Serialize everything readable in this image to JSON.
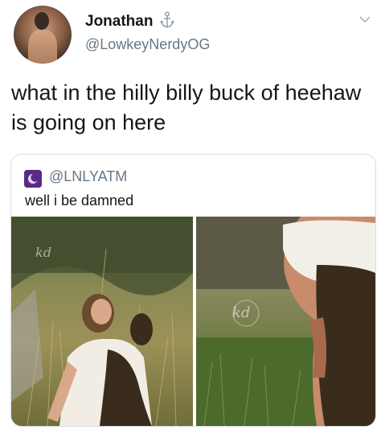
{
  "tweet": {
    "author_name": "Jonathan",
    "author_handle": "@LowkeyNerdyOG",
    "badge_icon": "anchor-icon",
    "menu_icon": "chevron-down-icon",
    "text": "what in the hilly billy buck of heehaw is going on here"
  },
  "quoted_tweet": {
    "author_handle": "@LNLYATM",
    "avatar_icon": "crescent-moon-icon",
    "text": "well i be damned",
    "photos": [
      {
        "name": "photo-woman-with-bees-sitting",
        "watermark": "kd"
      },
      {
        "name": "photo-bees-on-dress-closeup",
        "watermark": "kd"
      }
    ]
  },
  "colors": {
    "text_primary": "#14171a",
    "text_secondary": "#657786",
    "border": "#d8dee3",
    "avatar_purple": "#5b2a86"
  }
}
